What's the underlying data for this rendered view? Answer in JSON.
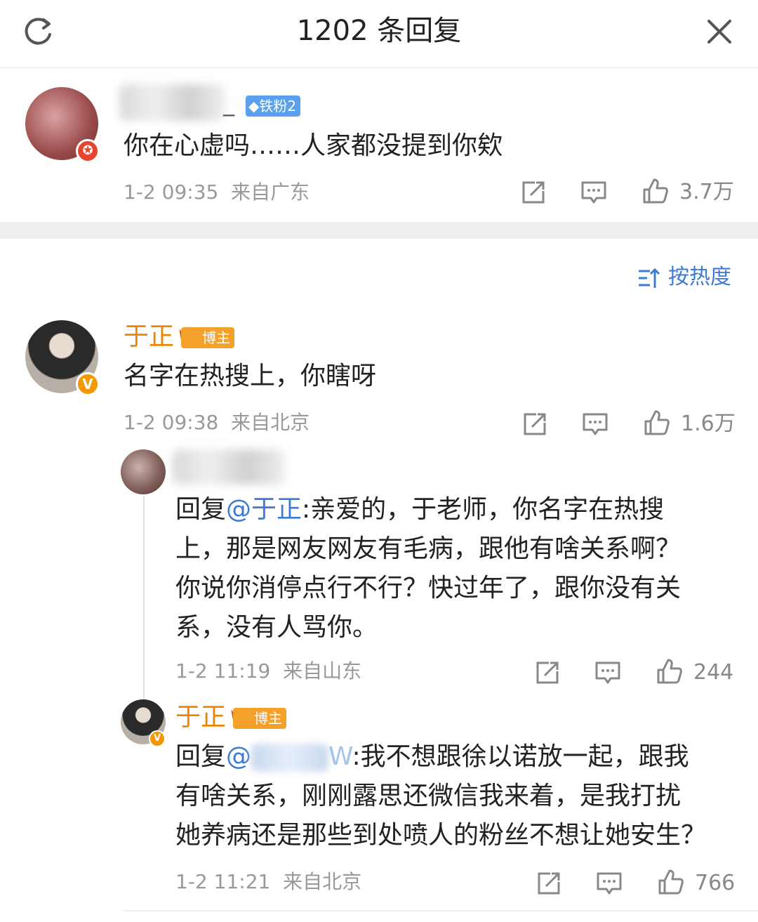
{
  "header": {
    "title": "1202 条回复"
  },
  "root_comment": {
    "badge": "铁粉2",
    "name_suffix": "_",
    "text": "你在心虚吗……人家都没提到你欸",
    "time": "1-2 09:35",
    "location": "来自广东",
    "likes": "3.7万"
  },
  "sort": {
    "label": "按热度"
  },
  "comments": [
    {
      "name": "于正",
      "badge": "博主",
      "text": "名字在热搜上，你瞎呀",
      "time": "1-2 09:38",
      "location": "来自北京",
      "likes": "1.6万"
    }
  ],
  "replies": [
    {
      "prefix": "回复",
      "mention": "@于正",
      "text_lines": [
        ":亲爱的，于老师，你名字在热搜",
        "上，那是网友网友有毛病，跟他有啥关系啊？",
        "你说你消停点行不行？快过年了，跟你没有关",
        "系，没有人骂你。"
      ],
      "time": "1-2 11:19",
      "location": "来自山东",
      "likes": "244"
    },
    {
      "name": "于正",
      "badge": "博主",
      "prefix": "回复",
      "mention": "@",
      "mention_tail": "W",
      "text_lines": [
        ":我不想跟徐以诺放一起，跟我",
        "有啥关系，刚刚露思还微信我来着，是我打扰",
        "她养病还是那些到处喷人的粉丝不想让她安生？"
      ],
      "time": "1-2 11:21",
      "location": "来自北京",
      "likes": "766"
    }
  ],
  "colors": {
    "orange_name": "#f08300",
    "mention": "#3b7bd6",
    "meta": "#999999"
  }
}
